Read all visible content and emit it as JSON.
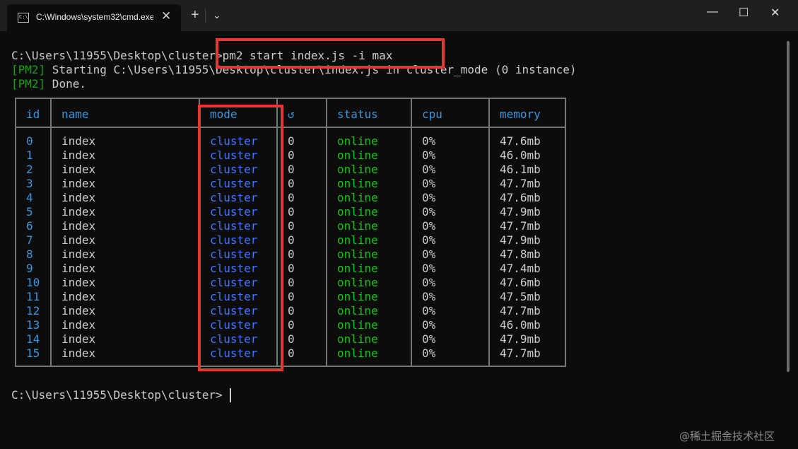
{
  "window": {
    "tab_title": "C:\\Windows\\system32\\cmd.exe",
    "tab_icon_text": "C:\\",
    "tab_close": "✕",
    "new_tab": "+",
    "dropdown": "⌄",
    "minimize": "—",
    "maximize": "☐",
    "close": "✕"
  },
  "terminal": {
    "prompt": "C:\\Users\\11955\\Desktop\\cluster>",
    "command": "pm2 start index.js -i max",
    "pm2_tag": "[PM2]",
    "starting_text": " Starting C:\\Users\\11955\\Desktop\\cluster\\index.js in cluster_mode (0 instance)",
    "done_text": " Done.",
    "final_prompt": "C:\\Users\\11955\\Desktop\\cluster>"
  },
  "table": {
    "headers": {
      "id": "id",
      "name": "name",
      "mode": "mode",
      "restart": "↺",
      "status": "status",
      "cpu": "cpu",
      "memory": "memory"
    },
    "rows": [
      {
        "id": "0",
        "name": "index",
        "mode": "cluster",
        "restart": "0",
        "status": "online",
        "cpu": "0%",
        "memory": "47.6mb"
      },
      {
        "id": "1",
        "name": "index",
        "mode": "cluster",
        "restart": "0",
        "status": "online",
        "cpu": "0%",
        "memory": "46.0mb"
      },
      {
        "id": "2",
        "name": "index",
        "mode": "cluster",
        "restart": "0",
        "status": "online",
        "cpu": "0%",
        "memory": "46.1mb"
      },
      {
        "id": "3",
        "name": "index",
        "mode": "cluster",
        "restart": "0",
        "status": "online",
        "cpu": "0%",
        "memory": "47.7mb"
      },
      {
        "id": "4",
        "name": "index",
        "mode": "cluster",
        "restart": "0",
        "status": "online",
        "cpu": "0%",
        "memory": "47.6mb"
      },
      {
        "id": "5",
        "name": "index",
        "mode": "cluster",
        "restart": "0",
        "status": "online",
        "cpu": "0%",
        "memory": "47.9mb"
      },
      {
        "id": "6",
        "name": "index",
        "mode": "cluster",
        "restart": "0",
        "status": "online",
        "cpu": "0%",
        "memory": "47.7mb"
      },
      {
        "id": "7",
        "name": "index",
        "mode": "cluster",
        "restart": "0",
        "status": "online",
        "cpu": "0%",
        "memory": "47.9mb"
      },
      {
        "id": "8",
        "name": "index",
        "mode": "cluster",
        "restart": "0",
        "status": "online",
        "cpu": "0%",
        "memory": "47.8mb"
      },
      {
        "id": "9",
        "name": "index",
        "mode": "cluster",
        "restart": "0",
        "status": "online",
        "cpu": "0%",
        "memory": "47.4mb"
      },
      {
        "id": "10",
        "name": "index",
        "mode": "cluster",
        "restart": "0",
        "status": "online",
        "cpu": "0%",
        "memory": "47.6mb"
      },
      {
        "id": "11",
        "name": "index",
        "mode": "cluster",
        "restart": "0",
        "status": "online",
        "cpu": "0%",
        "memory": "47.5mb"
      },
      {
        "id": "12",
        "name": "index",
        "mode": "cluster",
        "restart": "0",
        "status": "online",
        "cpu": "0%",
        "memory": "47.7mb"
      },
      {
        "id": "13",
        "name": "index",
        "mode": "cluster",
        "restart": "0",
        "status": "online",
        "cpu": "0%",
        "memory": "46.0mb"
      },
      {
        "id": "14",
        "name": "index",
        "mode": "cluster",
        "restart": "0",
        "status": "online",
        "cpu": "0%",
        "memory": "47.9mb"
      },
      {
        "id": "15",
        "name": "index",
        "mode": "cluster",
        "restart": "0",
        "status": "online",
        "cpu": "0%",
        "memory": "47.7mb"
      }
    ]
  },
  "watermark": "@稀土掘金技术社区",
  "colors": {
    "background": "#0c0c0c",
    "text": "#cccccc",
    "pm2_green": "#13a10e",
    "online_green": "#16c60c",
    "mode_blue": "#3b78ff",
    "header_cyan": "#3a96dd",
    "highlight_red": "#e63535"
  }
}
